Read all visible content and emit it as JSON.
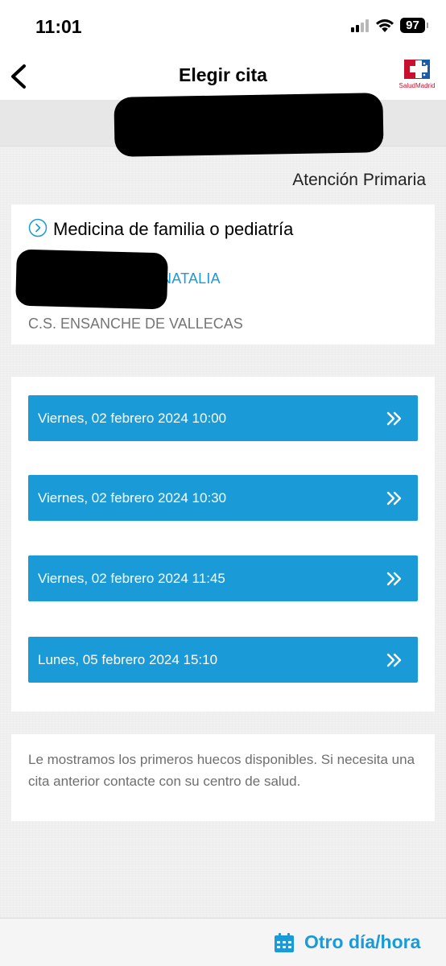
{
  "status_bar": {
    "time": "11:01",
    "battery": "97"
  },
  "nav": {
    "title": "Elegir cita",
    "logo_text": "SaludMadrid"
  },
  "section_label": "Atención Primaria",
  "info": {
    "specialty": "Medicina de familia o pediatría",
    "doctor": "DELTORO PRIETO NATALIA",
    "center": "C.S. ENSANCHE DE VALLECAS"
  },
  "slots": [
    {
      "label": "Viernes, 02 febrero 2024 10:00"
    },
    {
      "label": "Viernes, 02 febrero 2024 10:30"
    },
    {
      "label": "Viernes, 02 febrero 2024 11:45"
    },
    {
      "label": "Lunes, 05 febrero 2024 15:10"
    }
  ],
  "note": "Le mostramos los primeros huecos disponibles. Si necesita una cita anterior contacte con su centro de salud.",
  "bottom": {
    "other_label": "Otro día/hora"
  },
  "colors": {
    "accent": "#1a9ad6",
    "brand_red": "#c8102e"
  }
}
